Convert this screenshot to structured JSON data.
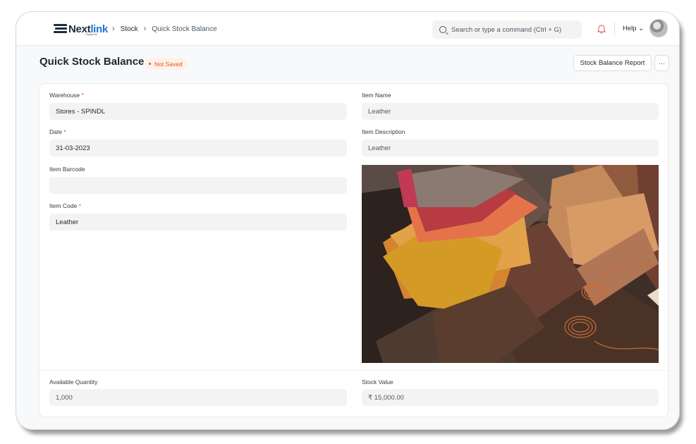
{
  "navbar": {
    "logo_text_dark": "Next",
    "logo_text_blue": "link",
    "logo_sub": "+Systems",
    "breadcrumb": [
      "Stock",
      "Quick Stock Balance"
    ],
    "search_placeholder": "Search or type a command (Ctrl + G)",
    "help_label": "Help ⌄",
    "icons": {
      "logo": "nextlink-logo-icon",
      "search": "search-icon",
      "notifications": "bell-icon",
      "avatar": "user-avatar"
    }
  },
  "page": {
    "title": "Quick Stock Balance",
    "status": "Not Saved",
    "report_button": "Stock Balance Report",
    "more_button": "···"
  },
  "form": {
    "warehouse": {
      "label": "Warehouse",
      "value": "Stores - SPINDL",
      "required": true
    },
    "date": {
      "label": "Date",
      "value": "31-03-2023",
      "required": true
    },
    "item_barcode": {
      "label": "Item Barcode",
      "value": ""
    },
    "item_code": {
      "label": "Item Code",
      "value": "Leather",
      "required": true
    },
    "item_name": {
      "label": "Item Name",
      "value": "Leather"
    },
    "item_description": {
      "label": "Item Description",
      "value": "Leather"
    },
    "available_quantity": {
      "label": "Available Quantity",
      "value": "1,000"
    },
    "stock_value": {
      "label": "Stock Value",
      "value": "₹ 15,000.00"
    }
  },
  "colors": {
    "accent_blue": "#1e73d8",
    "status_orange": "#e2561a",
    "required_red": "#e24c4c"
  }
}
